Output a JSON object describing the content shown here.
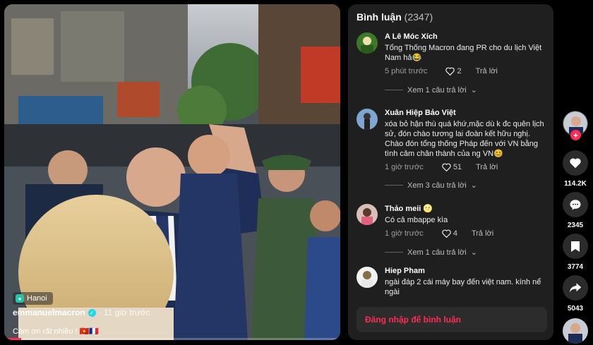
{
  "video": {
    "location": "Hanoi",
    "author": "emmanuelmacron",
    "posted": "· 11 giờ trước",
    "caption": "Cảm ơn rất nhiều ! 🇻🇳🇫🇷",
    "progress": 0.05
  },
  "comments_panel": {
    "title": "Bình luận",
    "count": "(2347)",
    "login_prompt": "Đăng nhập để bình luận",
    "comments": [
      {
        "author": "A Lê Móc Xích",
        "text": "Tổng Thống Macron đang PR cho du lịch Việt Nam hả😂",
        "time": "5 phút trước",
        "likes": "2",
        "reply_label": "Trả lời",
        "view_replies": "Xem 1 câu trả lời"
      },
      {
        "author": "Xuân Hiệp Bảo Việt",
        "text": "xóa bỏ hận thù quá khứ,mặc dù k đc quên lịch sử, đón chào tương lai đoàn kết hữu nghị. Chào đón tổng thống Pháp đến với VN bằng tình cảm chân thành của ng VN😊",
        "time": "1 giờ trước",
        "likes": "51",
        "reply_label": "Trả lời",
        "view_replies": "Xem 3 câu trả lời"
      },
      {
        "author": "Thảo meii 🌝",
        "text": "Có cả mbappe kìa",
        "time": "1 giờ trước",
        "likes": "4",
        "reply_label": "Trả lời",
        "view_replies": "Xem 1 câu trả lời"
      },
      {
        "author": "Hiep Pham",
        "text": "ngài đáp 2 cái máy bay đến việt nam. kính nể ngài"
      }
    ]
  },
  "actions": {
    "likes": "114.2K",
    "comments": "2345",
    "saves": "3774",
    "shares": "5043"
  },
  "colors": {
    "accent": "#fe2c55",
    "panel_bg": "#1f1f1f",
    "verified": "#20d5ec"
  }
}
